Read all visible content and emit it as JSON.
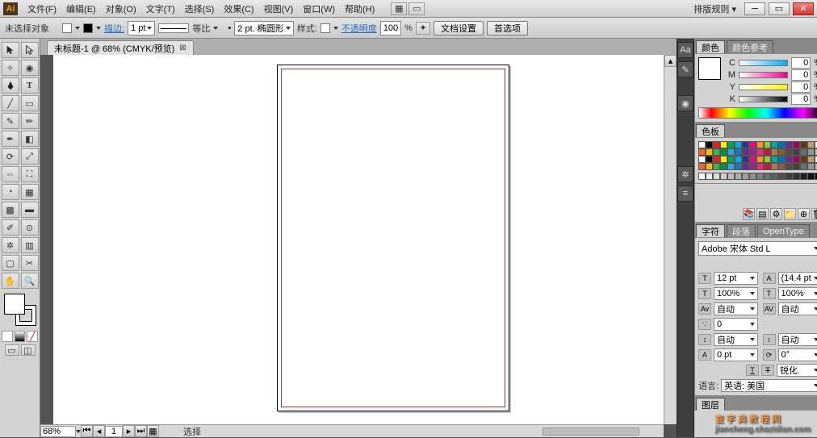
{
  "menu": {
    "items": [
      "文件(F)",
      "编辑(E)",
      "对象(O)",
      "文字(T)",
      "选择(S)",
      "效果(C)",
      "视图(V)",
      "窗口(W)",
      "帮助(H)"
    ],
    "layout_label": "排版规则"
  },
  "options": {
    "selection": "未选择对象",
    "stroke_label": "描边:",
    "stroke_pt": "1 pt",
    "uniform": "等比",
    "dash": "2 pt. 椭圆形",
    "style_label": "样式:",
    "opacity_label": "不透明度",
    "opacity": "100",
    "pct": "%",
    "docsetup": "文档设置",
    "prefs": "首选项"
  },
  "document": {
    "tab": "未标题-1 @ 68% (CMYK/预览)",
    "zoom": "68%",
    "page": "1",
    "status": "选择"
  },
  "panels": {
    "color": {
      "tab1": "颜色",
      "tab2": "颜色参考",
      "channels": [
        "C",
        "M",
        "Y",
        "K"
      ],
      "vals": [
        "0",
        "0",
        "0",
        "0"
      ],
      "pct": "%"
    },
    "swatch": {
      "tab": "色板"
    },
    "char": {
      "tab1": "字符",
      "tab2": "段落",
      "tab3": "OpenType",
      "font": "Adobe 宋体 Std L",
      "size": "12 pt",
      "leading": "(14.4 pt",
      "hscale": "100%",
      "vscale": "100%",
      "kerning": "自动",
      "tracking": "0",
      "baseline": "自动",
      "auto2": "自动",
      "pt0": "0 pt",
      "deg0": "0°",
      "aa": "锐化",
      "lang_label": "语言:",
      "lang": "英语: 美国"
    },
    "layers": {
      "tab": "图层"
    }
  },
  "watermark": {
    "a": "查 字 典 教 程 网",
    "b": "jiaocheng.chazidian.com"
  }
}
